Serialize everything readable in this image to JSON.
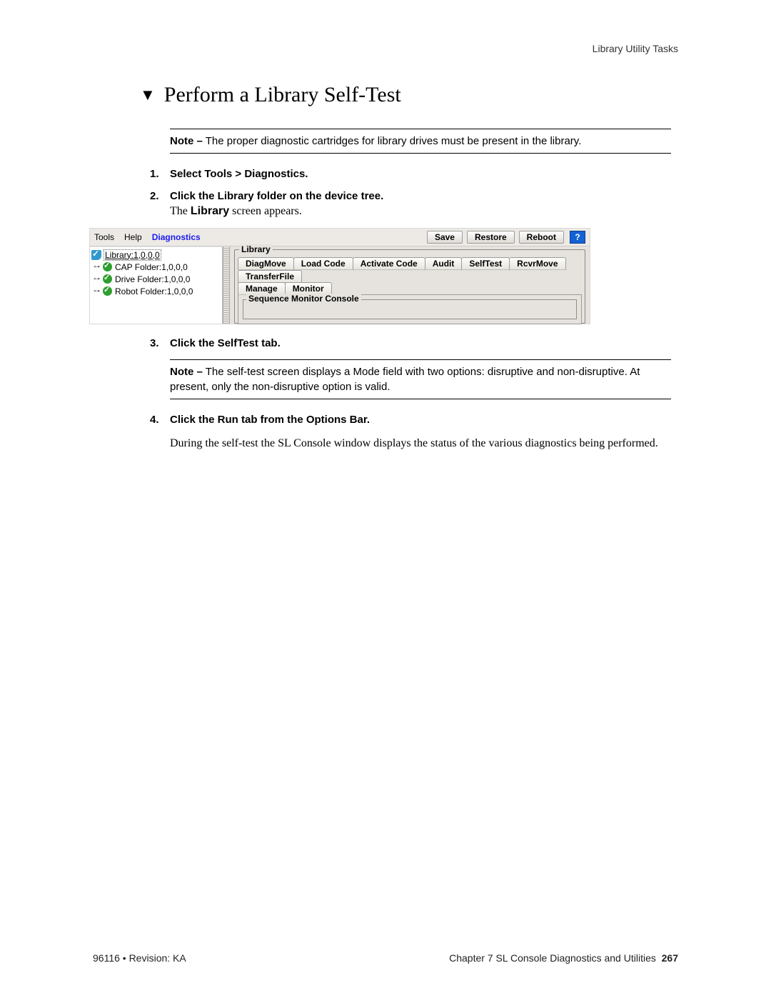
{
  "header": {
    "section": "Library Utility Tasks"
  },
  "title": "Perform a Library Self-Test",
  "note1": {
    "label": "Note –",
    "text": " The proper diagnostic cartridges for library drives must be present in the library."
  },
  "steps": {
    "s1": {
      "num": "1.",
      "text": "Select Tools > Diagnostics."
    },
    "s2": {
      "num": "2.",
      "text": "Click the Library folder on the device tree.",
      "after_label": "The ",
      "after_bold": "Library",
      "after_tail": " screen appears."
    },
    "s3": {
      "num": "3.",
      "text": "Click the SelfTest tab."
    },
    "s4": {
      "num": "4.",
      "text": "Click the Run tab from the Options Bar."
    }
  },
  "note2": {
    "label": "Note –",
    "text": " The self-test screen displays a Mode field with two options: disruptive and non-disruptive. At present, only the non-disruptive option is valid."
  },
  "para_after_s4": "During the self-test the SL Console window displays the status of the various diagnostics being performed.",
  "app": {
    "menubar": {
      "tools": "Tools",
      "help": "Help",
      "diagnostics": "Diagnostics"
    },
    "buttons": {
      "save": "Save",
      "restore": "Restore",
      "reboot": "Reboot",
      "help": "?"
    },
    "tree": {
      "root": "Library:1,0,0,0",
      "cap": "CAP Folder:1,0,0,0",
      "drive": "Drive Folder:1,0,0,0",
      "robot": "Robot Folder:1,0,0,0"
    },
    "panel": {
      "legend": "Library",
      "tabs": {
        "diagmove": "DiagMove",
        "loadcode": "Load Code",
        "activatecode": "Activate Code",
        "audit": "Audit",
        "selftest": "SelfTest",
        "rcvrmove": "RcvrMove",
        "transferfile": "TransferFile",
        "manage": "Manage",
        "monitor": "Monitor"
      },
      "inner_legend": "Sequence Monitor Console"
    }
  },
  "footer": {
    "left": "96116 • Revision: KA",
    "right_prefix": "Chapter 7 SL Console Diagnostics and Utilities",
    "page": "267"
  }
}
